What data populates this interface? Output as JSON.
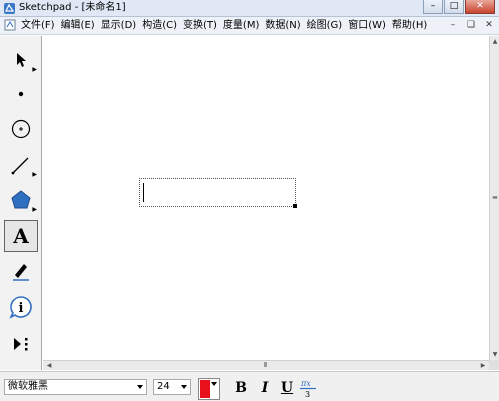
{
  "window": {
    "title": "Sketchpad  - [未命名1]"
  },
  "menu": {
    "items": [
      {
        "label": "文件(F)"
      },
      {
        "label": "编辑(E)"
      },
      {
        "label": "显示(D)"
      },
      {
        "label": "构造(C)"
      },
      {
        "label": "变换(T)"
      },
      {
        "label": "度量(M)"
      },
      {
        "label": "数据(N)"
      },
      {
        "label": "绘图(G)"
      },
      {
        "label": "窗口(W)"
      },
      {
        "label": "帮助(H)"
      }
    ]
  },
  "toolbox": {
    "tools": [
      {
        "icon": "arrow-select-icon"
      },
      {
        "icon": "point-icon"
      },
      {
        "icon": "compass-icon"
      },
      {
        "icon": "straightedge-icon"
      },
      {
        "icon": "polygon-icon"
      },
      {
        "icon": "text-icon",
        "label": "A",
        "active": true
      },
      {
        "icon": "marker-icon"
      },
      {
        "icon": "information-icon"
      },
      {
        "icon": "custom-tool-icon"
      }
    ]
  },
  "format_bar": {
    "font": "微软雅黑",
    "size": "24",
    "color": "#e8101a",
    "bold_label": "B",
    "italic_label": "I",
    "underline_label": "U"
  },
  "scrollbar": {
    "grip": "III"
  },
  "colors": {
    "titlebar": "#dfe8f4",
    "text_color": "#e8101a",
    "tool_blue": "#2f6fc0"
  }
}
